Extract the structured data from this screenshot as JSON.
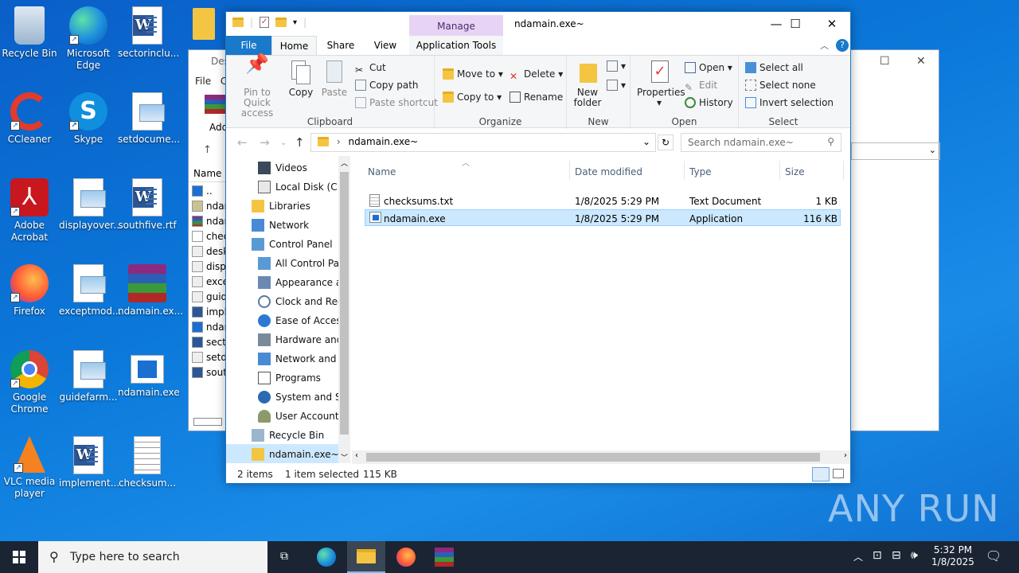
{
  "desktop": {
    "icons": [
      {
        "label": "Recycle Bin",
        "icon": "recycle-bin-icon"
      },
      {
        "label": "Microsoft Edge",
        "icon": "edge-icon"
      },
      {
        "label": "sectorinclu...",
        "icon": "word-document-icon"
      },
      {
        "label": "CCleaner",
        "icon": "ccleaner-icon"
      },
      {
        "label": "Skype",
        "icon": "skype-icon"
      },
      {
        "label": "setdocume...",
        "icon": "image-file-icon"
      },
      {
        "label": "Adobe Acrobat",
        "icon": "acrobat-icon"
      },
      {
        "label": "displayover...",
        "icon": "image-file-icon"
      },
      {
        "label": "southfive.rtf",
        "icon": "word-document-icon"
      },
      {
        "label": "Firefox",
        "icon": "firefox-icon"
      },
      {
        "label": "exceptmod...",
        "icon": "image-file-icon"
      },
      {
        "label": "ndamain.ex...",
        "icon": "winrar-archive-icon"
      },
      {
        "label": "Google Chrome",
        "icon": "chrome-icon"
      },
      {
        "label": "guidefarm...",
        "icon": "image-file-icon"
      },
      {
        "label": "ndamain.exe",
        "icon": "application-icon"
      },
      {
        "label": "VLC media player",
        "icon": "vlc-icon"
      },
      {
        "label": "implement...",
        "icon": "word-document-icon"
      },
      {
        "label": "checksum...",
        "icon": "text-file-icon"
      }
    ]
  },
  "back_window": {
    "title": "Des",
    "menu_file": "File",
    "menu_c": "C",
    "add_label": "Add",
    "name_header": "Name",
    "rows": [
      "..",
      "ndar",
      "ndar",
      "chec",
      "desk",
      "disp",
      "exce",
      "guid",
      "impl",
      "ndar",
      "secto",
      "setd",
      "sout"
    ]
  },
  "explorer": {
    "title": "ndamain.exe~",
    "manage_label": "Manage",
    "tabs": {
      "file": "File",
      "home": "Home",
      "share": "Share",
      "view": "View",
      "app_tools": "Application Tools"
    },
    "ribbon": {
      "clipboard": {
        "label": "Clipboard",
        "pin": "Pin to Quick access",
        "copy": "Copy",
        "paste": "Paste",
        "cut": "Cut",
        "copy_path": "Copy path",
        "paste_shortcut": "Paste shortcut"
      },
      "organize": {
        "label": "Organize",
        "move_to": "Move to",
        "copy_to": "Copy to",
        "delete": "Delete",
        "rename": "Rename"
      },
      "new": {
        "label": "New",
        "new_folder": "New folder"
      },
      "open": {
        "label": "Open",
        "properties": "Properties",
        "open": "Open",
        "edit": "Edit",
        "history": "History"
      },
      "select": {
        "label": "Select",
        "select_all": "Select all",
        "select_none": "Select none",
        "invert": "Invert selection"
      }
    },
    "address": {
      "path": "ndamain.exe~",
      "search_placeholder": "Search ndamain.exe~"
    },
    "nav": [
      {
        "label": "Videos",
        "icon": "videos-icon"
      },
      {
        "label": "Local Disk (C:)",
        "icon": "drive-icon"
      },
      {
        "label": "Libraries",
        "icon": "libraries-icon"
      },
      {
        "label": "Network",
        "icon": "network-icon"
      },
      {
        "label": "Control Panel",
        "icon": "control-panel-icon"
      },
      {
        "label": "All Control Par",
        "icon": "control-panel-icon"
      },
      {
        "label": "Appearance an",
        "icon": "appearance-icon"
      },
      {
        "label": "Clock and Regi",
        "icon": "clock-icon"
      },
      {
        "label": "Ease of Access",
        "icon": "ease-of-access-icon"
      },
      {
        "label": "Hardware and",
        "icon": "hardware-icon"
      },
      {
        "label": "Network and Ir",
        "icon": "network-internet-icon"
      },
      {
        "label": "Programs",
        "icon": "programs-icon"
      },
      {
        "label": "System and Se",
        "icon": "system-security-icon"
      },
      {
        "label": "User Accounts",
        "icon": "user-accounts-icon"
      },
      {
        "label": "Recycle Bin",
        "icon": "recycle-bin-icon"
      },
      {
        "label": "ndamain.exe~",
        "icon": "folder-icon"
      }
    ],
    "columns": {
      "name": "Name",
      "date": "Date modified",
      "type": "Type",
      "size": "Size"
    },
    "files": [
      {
        "name": "checksums.txt",
        "date": "1/8/2025 5:29 PM",
        "type": "Text Document",
        "size": "1 KB"
      },
      {
        "name": "ndamain.exe",
        "date": "1/8/2025 5:29 PM",
        "type": "Application",
        "size": "116 KB"
      }
    ],
    "status": {
      "items": "2 items",
      "selected": "1 item selected",
      "size": "115 KB"
    }
  },
  "taskbar": {
    "search_placeholder": "Type here to search",
    "time": "5:32 PM",
    "date": "1/8/2025"
  },
  "watermark": "ANY RUN"
}
